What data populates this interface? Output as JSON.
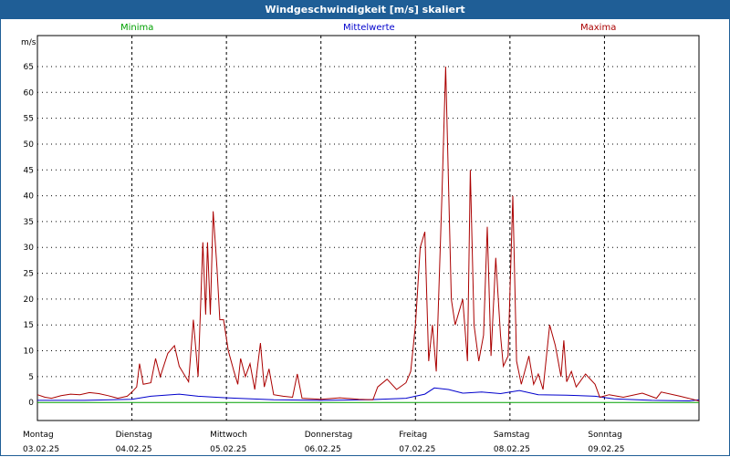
{
  "title": "Windgeschwindigkeit [m/s] skaliert",
  "colors": {
    "header": "#1f5e96",
    "minima": "#00a000",
    "mittel": "#0000cc",
    "maxima": "#aa0000"
  },
  "chart_data": {
    "type": "line",
    "title": "Windgeschwindigkeit [m/s] skaliert",
    "ylabel": "m/s",
    "ylim": [
      -3.5,
      71
    ],
    "yticks": [
      0,
      5,
      10,
      15,
      20,
      25,
      30,
      35,
      40,
      45,
      50,
      55,
      60,
      65
    ],
    "xlim": [
      0,
      7
    ],
    "grid": true,
    "legend_position": "top",
    "days": [
      {
        "name": "Montag",
        "date": "03.02.25"
      },
      {
        "name": "Dienstag",
        "date": "04.02.25"
      },
      {
        "name": "Mittwoch",
        "date": "05.02.25"
      },
      {
        "name": "Donnerstag",
        "date": "06.02.25"
      },
      {
        "name": "Freitag",
        "date": "07.02.25"
      },
      {
        "name": "Samstag",
        "date": "08.02.25"
      },
      {
        "name": "Sonntag",
        "date": "09.02.25"
      }
    ],
    "series": [
      {
        "name": "Minima",
        "color": "#00a000",
        "points": [
          [
            0,
            0
          ],
          [
            7,
            0
          ]
        ]
      },
      {
        "name": "Mittelwerte",
        "color": "#0000cc",
        "points": [
          [
            0,
            0.4
          ],
          [
            0.5,
            0.4
          ],
          [
            1.0,
            0.6
          ],
          [
            1.2,
            1.2
          ],
          [
            1.5,
            1.6
          ],
          [
            1.7,
            1.2
          ],
          [
            2.0,
            0.9
          ],
          [
            2.5,
            0.5
          ],
          [
            3.0,
            0.4
          ],
          [
            3.5,
            0.5
          ],
          [
            3.9,
            0.8
          ],
          [
            4.1,
            1.6
          ],
          [
            4.2,
            2.8
          ],
          [
            4.35,
            2.5
          ],
          [
            4.5,
            1.8
          ],
          [
            4.7,
            2.0
          ],
          [
            4.9,
            1.7
          ],
          [
            5.1,
            2.3
          ],
          [
            5.3,
            1.5
          ],
          [
            5.6,
            1.4
          ],
          [
            5.9,
            1.2
          ],
          [
            6.1,
            0.7
          ],
          [
            6.5,
            0.4
          ],
          [
            6.9,
            0.3
          ],
          [
            7.0,
            0.5
          ]
        ]
      },
      {
        "name": "Maxima",
        "color": "#aa0000",
        "points": [
          [
            0,
            1.5
          ],
          [
            0.08,
            1.0
          ],
          [
            0.15,
            0.8
          ],
          [
            0.25,
            1.3
          ],
          [
            0.35,
            1.6
          ],
          [
            0.45,
            1.5
          ],
          [
            0.55,
            1.9
          ],
          [
            0.65,
            1.7
          ],
          [
            0.75,
            1.3
          ],
          [
            0.85,
            0.8
          ],
          [
            0.95,
            1.2
          ],
          [
            1.0,
            2.0
          ],
          [
            1.05,
            3.0
          ],
          [
            1.08,
            7.5
          ],
          [
            1.12,
            3.5
          ],
          [
            1.2,
            3.8
          ],
          [
            1.25,
            8.5
          ],
          [
            1.3,
            5.0
          ],
          [
            1.38,
            9.5
          ],
          [
            1.45,
            11.0
          ],
          [
            1.5,
            7.0
          ],
          [
            1.55,
            5.5
          ],
          [
            1.6,
            4.0
          ],
          [
            1.65,
            16.0
          ],
          [
            1.7,
            5.0
          ],
          [
            1.75,
            31.0
          ],
          [
            1.78,
            17.0
          ],
          [
            1.8,
            31.0
          ],
          [
            1.83,
            17.0
          ],
          [
            1.86,
            37.0
          ],
          [
            1.9,
            26.0
          ],
          [
            1.93,
            16.0
          ],
          [
            1.97,
            16.0
          ],
          [
            2.02,
            10.0
          ],
          [
            2.08,
            6.0
          ],
          [
            2.12,
            3.5
          ],
          [
            2.15,
            8.5
          ],
          [
            2.2,
            5.0
          ],
          [
            2.25,
            7.5
          ],
          [
            2.3,
            2.5
          ],
          [
            2.36,
            11.5
          ],
          [
            2.4,
            3.0
          ],
          [
            2.45,
            6.5
          ],
          [
            2.5,
            1.5
          ],
          [
            2.6,
            1.2
          ],
          [
            2.7,
            1.0
          ],
          [
            2.75,
            5.5
          ],
          [
            2.8,
            0.8
          ],
          [
            3.0,
            0.6
          ],
          [
            3.2,
            0.9
          ],
          [
            3.4,
            0.6
          ],
          [
            3.55,
            0.5
          ],
          [
            3.6,
            3.0
          ],
          [
            3.7,
            4.5
          ],
          [
            3.8,
            2.5
          ],
          [
            3.9,
            3.8
          ],
          [
            3.95,
            6.0
          ],
          [
            4.0,
            15.0
          ],
          [
            4.05,
            30.0
          ],
          [
            4.1,
            33.0
          ],
          [
            4.14,
            8.0
          ],
          [
            4.18,
            15.0
          ],
          [
            4.22,
            6.0
          ],
          [
            4.28,
            40.0
          ],
          [
            4.32,
            65.0
          ],
          [
            4.38,
            20.0
          ],
          [
            4.42,
            15.0
          ],
          [
            4.5,
            20.0
          ],
          [
            4.55,
            8.0
          ],
          [
            4.58,
            45.0
          ],
          [
            4.62,
            15.0
          ],
          [
            4.67,
            8.0
          ],
          [
            4.72,
            13.0
          ],
          [
            4.76,
            34.0
          ],
          [
            4.8,
            9.0
          ],
          [
            4.85,
            28.0
          ],
          [
            4.9,
            13.0
          ],
          [
            4.93,
            7.0
          ],
          [
            4.98,
            9.0
          ],
          [
            5.03,
            40.0
          ],
          [
            5.07,
            8.0
          ],
          [
            5.12,
            3.5
          ],
          [
            5.2,
            9.0
          ],
          [
            5.25,
            3.5
          ],
          [
            5.3,
            5.5
          ],
          [
            5.35,
            2.5
          ],
          [
            5.42,
            15.0
          ],
          [
            5.48,
            11.0
          ],
          [
            5.54,
            5.0
          ],
          [
            5.57,
            12.0
          ],
          [
            5.6,
            4.0
          ],
          [
            5.65,
            6.0
          ],
          [
            5.7,
            3.0
          ],
          [
            5.8,
            5.5
          ],
          [
            5.9,
            3.5
          ],
          [
            5.95,
            1.0
          ],
          [
            6.05,
            1.5
          ],
          [
            6.2,
            1.0
          ],
          [
            6.4,
            1.8
          ],
          [
            6.55,
            0.8
          ],
          [
            6.6,
            2.0
          ],
          [
            6.8,
            1.2
          ],
          [
            7.0,
            0.3
          ]
        ]
      }
    ]
  }
}
